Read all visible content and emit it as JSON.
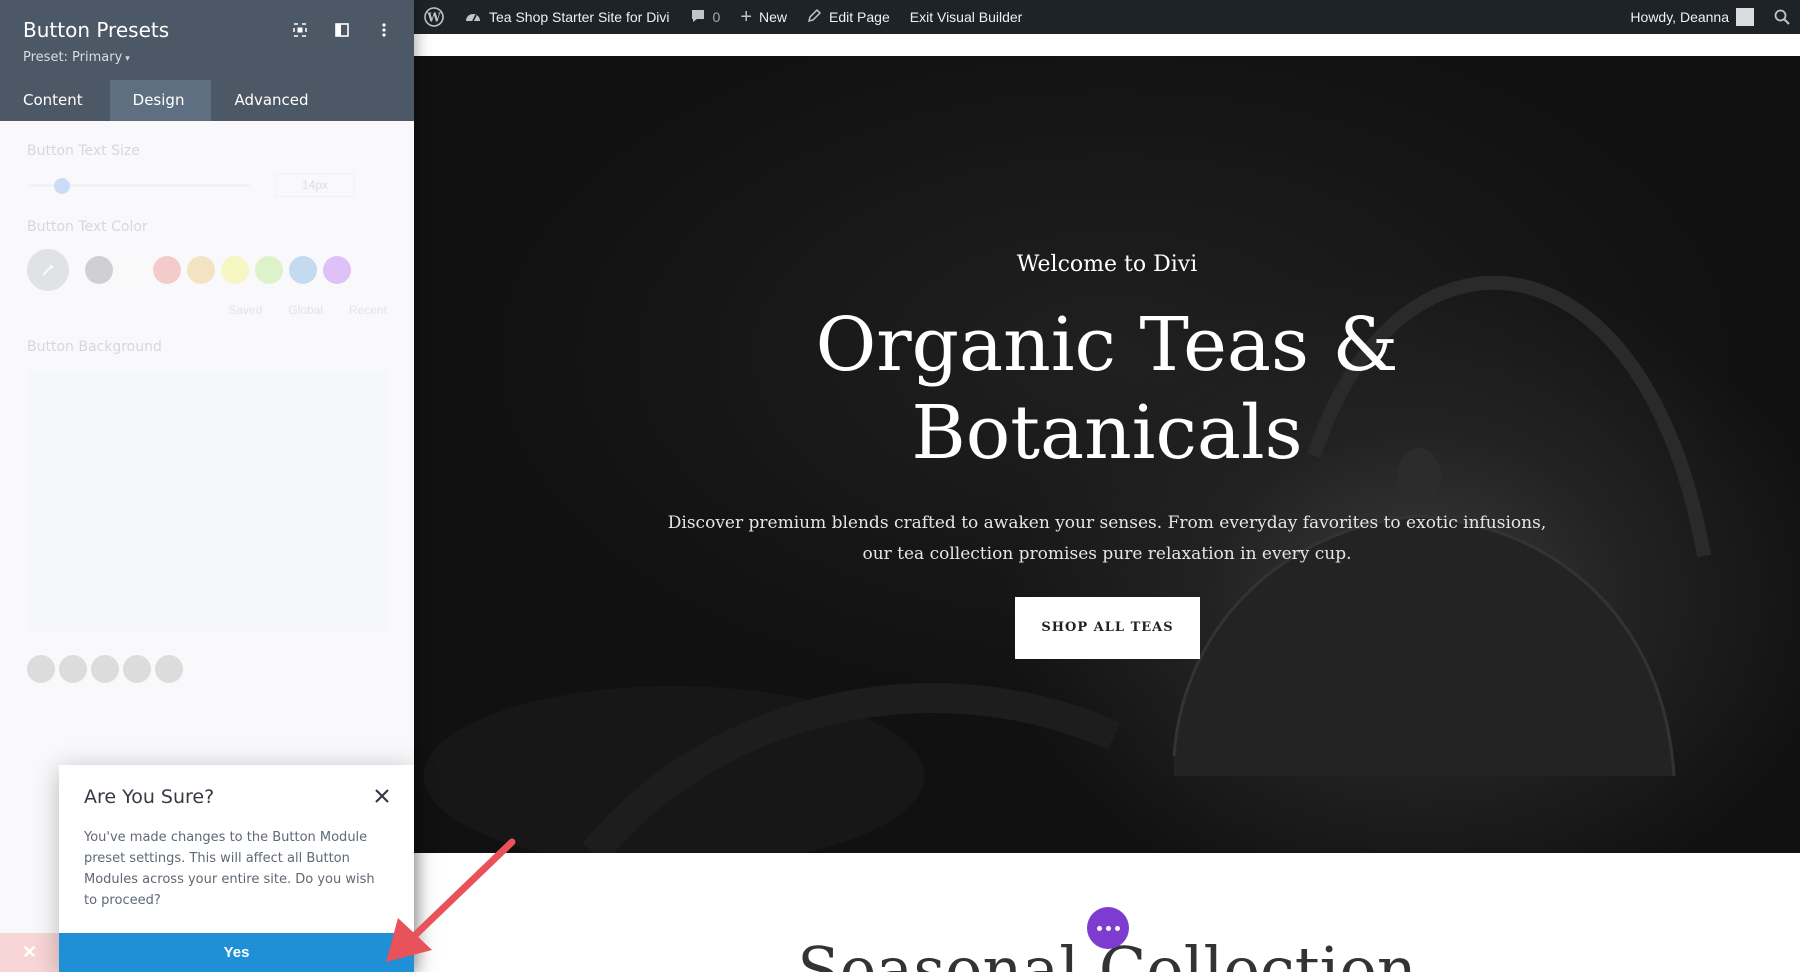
{
  "panel": {
    "title": "Button Presets",
    "preset_label": "Preset: Primary",
    "tabs": [
      {
        "label": "Content"
      },
      {
        "label": "Design"
      },
      {
        "label": "Advanced"
      }
    ],
    "fields": {
      "text_size_label": "Button Text Size",
      "text_size_value": "14px",
      "text_color_label": "Button Text Color",
      "color_tabs": [
        "Saved",
        "Global",
        "Recent"
      ],
      "background_label": "Button Background"
    }
  },
  "modal": {
    "title": "Are You Sure?",
    "message": "You've made changes to the Button Module preset settings. This will affect all Button Modules across your entire site. Do you wish to proceed?",
    "confirm_label": "Yes"
  },
  "adminbar": {
    "site_name": "Tea Shop Starter Site for Divi",
    "comments_count": "0",
    "new_label": "New",
    "edit_page_label": "Edit Page",
    "exit_label": "Exit Visual Builder",
    "greeting": "Howdy, Deanna"
  },
  "hero": {
    "eyebrow": "Welcome to Divi",
    "title_line1": "Organic Teas &",
    "title_line2": "Botanicals",
    "description": "Discover premium blends crafted to awaken your senses. From everyday favorites to exotic infusions, our tea collection promises pure relaxation in every cup.",
    "button_label": "SHOP ALL TEAS"
  },
  "section": {
    "title": "Seasonal Collection"
  },
  "colors": {
    "panel_header": "#4c5866",
    "active_tab": "#5e6f82",
    "adminbar": "#1d2327",
    "confirm_button": "#1f8fd6",
    "builder_dots": "#7e3bd0",
    "annotation_arrow": "#e8525a"
  }
}
